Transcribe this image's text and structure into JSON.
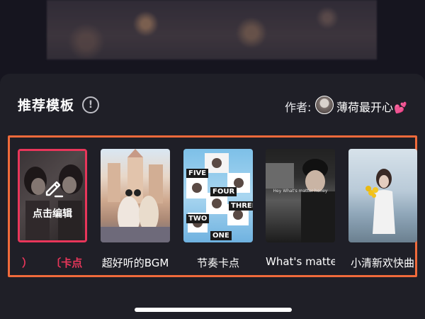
{
  "panel": {
    "title": "推荐模板",
    "author_label": "作者:",
    "author_name": "薄荷最开心",
    "author_emoji": "💕"
  },
  "templates": [
    {
      "overlay_text": "点击编辑",
      "label": "卡点",
      "label_prefix": "）",
      "label_prefix2": "〔",
      "selected": true
    },
    {
      "label": "超好听的BGM"
    },
    {
      "label": "节奏卡点",
      "tags": [
        "FIVE",
        "FOUR",
        "THREE",
        "TWO",
        "ONE"
      ]
    },
    {
      "label": "What's matte",
      "caption": "Hey What's matter honey"
    },
    {
      "label": "小清新欢快曲"
    }
  ],
  "colors": {
    "highlight_frame": "#f06a3b",
    "selected_border": "#e8365a",
    "selected_label": "#e8365a",
    "panel_bg": "#1f1f27"
  }
}
